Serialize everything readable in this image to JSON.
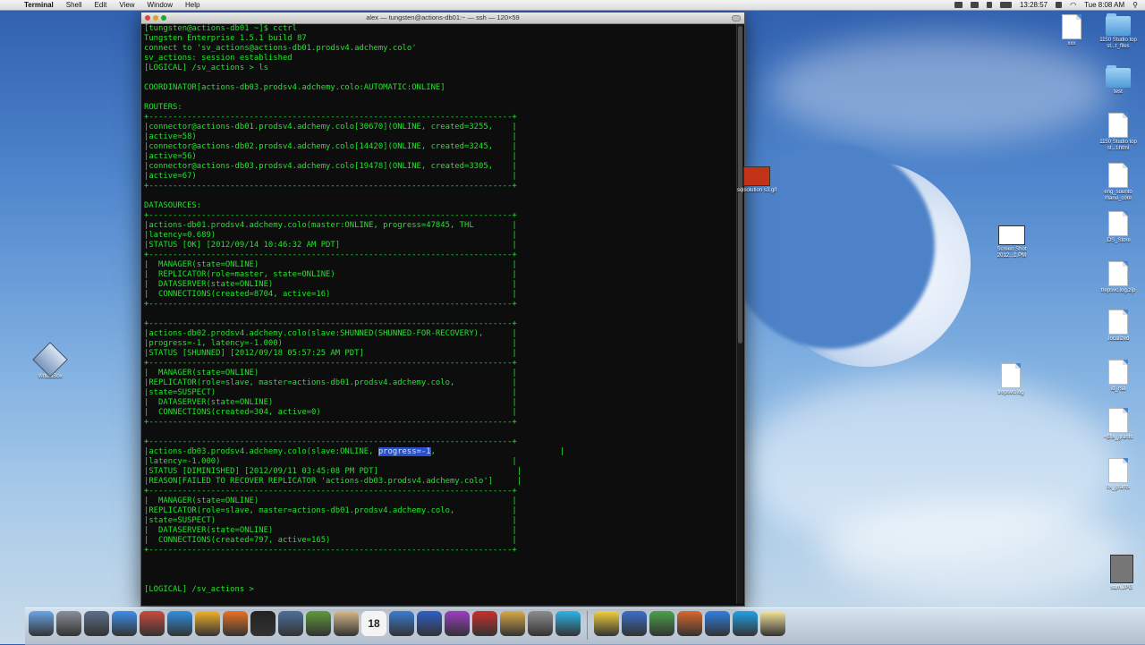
{
  "menubar": {
    "app_name": "Terminal",
    "menus": [
      "Shell",
      "Edit",
      "View",
      "Window",
      "Help"
    ],
    "time_remaining": "13:28:57",
    "clock": "Tue 8:08 AM"
  },
  "terminal": {
    "title": "alex — tungsten@actions-db01:~ — ssh — 120×59",
    "lines": [
      "[tungsten@actions-db01 ~]$ cctrl",
      "Tungsten Enterprise 1.5.1 build 87",
      "connect to 'sv_actions@actions-db01.prodsv4.adchemy.colo'",
      "sv_actions: session established",
      "[LOGICAL] /sv_actions > ls",
      "",
      "COORDINATOR[actions-db03.prodsv4.adchemy.colo:AUTOMATIC:ONLINE]",
      "",
      "ROUTERS:",
      "+----------------------------------------------------------------------------+",
      "|connector@actions-db01.prodsv4.adchemy.colo[30670](ONLINE, created=3255,    |",
      "|active=58)                                                                  |",
      "|connector@actions-db02.prodsv4.adchemy.colo[14420](ONLINE, created=3245,    |",
      "|active=56)                                                                  |",
      "|connector@actions-db03.prodsv4.adchemy.colo[19478](ONLINE, created=3305,    |",
      "|active=67)                                                                  |",
      "+----------------------------------------------------------------------------+",
      "",
      "DATASOURCES:",
      "+----------------------------------------------------------------------------+",
      "|actions-db01.prodsv4.adchemy.colo(master:ONLINE, progress=47845, THL        |",
      "|latency=0.689)                                                              |",
      "|STATUS [OK] [2012/09/14 10:46:32 AM PDT]                                    |",
      "+----------------------------------------------------------------------------+",
      "|  MANAGER(state=ONLINE)                                                     |",
      "|  REPLICATOR(role=master, state=ONLINE)                                     |",
      "|  DATASERVER(state=ONLINE)                                                  |",
      "|  CONNECTIONS(created=8704, active=16)                                      |",
      "+----------------------------------------------------------------------------+",
      "",
      "+----------------------------------------------------------------------------+",
      "|actions-db02.prodsv4.adchemy.colo(slave:SHUNNED(SHUNNED-FOR-RECOVERY),      |",
      "|progress=-1, latency=-1.000)                                                |",
      "|STATUS [SHUNNED] [2012/09/18 05:57:25 AM PDT]                               |",
      "+----------------------------------------------------------------------------+",
      "|  MANAGER(state=ONLINE)                                                     |",
      "|REPLICATOR(role=slave, master=actions-db01.prodsv4.adchemy.colo,            |",
      "|state=SUSPECT)                                                              |",
      "|  DATASERVER(state=ONLINE)                                                  |",
      "|  CONNECTIONS(created=304, active=0)                                        |",
      "+----------------------------------------------------------------------------+",
      "",
      "+----------------------------------------------------------------------------+",
      "|actions-db03.prodsv4.adchemy.colo(slave:ONLINE, ",
      "|latency=-1.000)                                                             |",
      "|STATUS [DIMINISHED] [2012/09/11 03:45:08 PM PDT]                             |",
      "|REASON[FAILED TO RECOVER REPLICATOR 'actions-db03.prodsv4.adchemy.colo']     |",
      "+----------------------------------------------------------------------------+",
      "|  MANAGER(state=ONLINE)                                                     |",
      "|REPLICATOR(role=slave, master=actions-db01.prodsv4.adchemy.colo,            |",
      "|state=SUSPECT)                                                              |",
      "|  DATASERVER(state=ONLINE)                                                  |",
      "|  CONNECTIONS(created=797, active=165)                                      |",
      "+----------------------------------------------------------------------------+",
      "",
      "",
      "",
      "[LOGICAL] /sv_actions > "
    ],
    "selected_text": "progress=-1",
    "after_selection": ",                          |"
  },
  "desktop_icons": [
    {
      "label": "xxx",
      "kind": "doc"
    },
    {
      "label": "1150 Studio top st...t_files",
      "kind": "folder"
    },
    {
      "label": "test",
      "kind": "folder"
    },
    {
      "label": "1150 Studio top st...t.html",
      "kind": "doc"
    },
    {
      "label": "eng_suunto manu_core",
      "kind": "doc"
    },
    {
      "label": ".DS_Store",
      "kind": "doc"
    },
    {
      "label": "trepsvc.log.zip",
      "kind": "doc"
    },
    {
      "label": ".localized",
      "kind": "doc"
    },
    {
      "label": "id_rsa",
      "kind": "doc"
    },
    {
      "label": "~$fix_grants",
      "kind": "doc"
    },
    {
      "label": "fix_grants",
      "kind": "doc"
    },
    {
      "label": "sqlsolution s3.gif",
      "kind": "image"
    },
    {
      "label": "Screen Shot 2012...1 PM",
      "kind": "image"
    },
    {
      "label": "trepsvc.log",
      "kind": "doc"
    },
    {
      "label": "VirtualBox",
      "kind": "app"
    },
    {
      "label": "sam.JPG",
      "kind": "image"
    }
  ],
  "dock": {
    "apps": [
      "finder-icon",
      "launchpad-icon",
      "mission-control-icon",
      "app-store-icon",
      "contacts-icon",
      "safari-icon",
      "flower-icon",
      "firefox-icon",
      "terminal-icon",
      "camera-icon",
      "evernote-icon",
      "notes-icon",
      "calendar-icon",
      "preview-icon",
      "itunes-icon",
      "music-icon",
      "office-icon",
      "iphoto-icon",
      "utility-icon",
      "messages-icon",
      "adium-icon",
      "word-icon",
      "excel-icon",
      "powerpoint-icon",
      "outlook-icon",
      "skype-icon",
      "stickies-icon"
    ],
    "calendar_day": "18"
  }
}
